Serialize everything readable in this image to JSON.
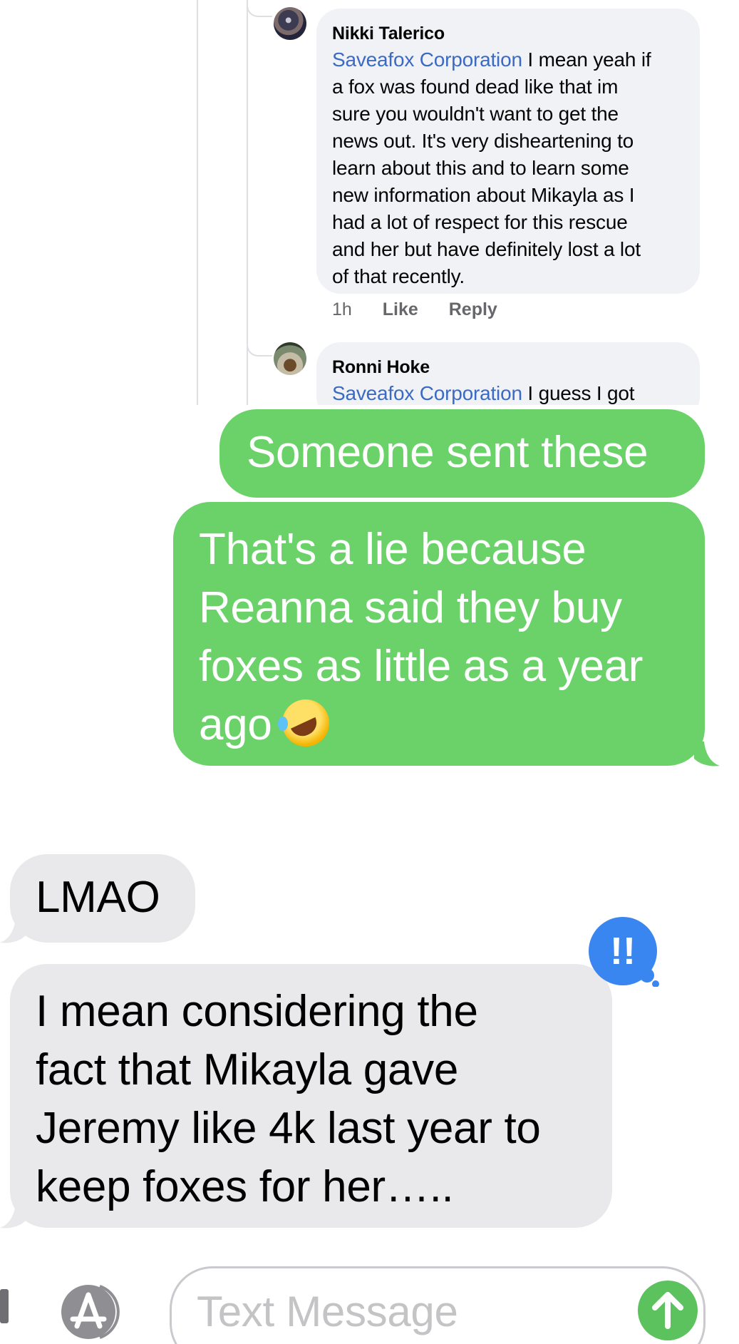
{
  "screenshot_comments": {
    "comment1": {
      "author": "Nikki Talerico",
      "mention": "Saveafox Corporation",
      "text_lines": [
        " I mean yeah if",
        "a fox was found dead like that im",
        "sure you wouldn't want to get the",
        "news out. It's very disheartening to",
        "learn about this and to learn some",
        "new information about Mikayla as I",
        "had a lot of respect for this rescue",
        "and her but have definitely lost a lot",
        "of that recently."
      ],
      "time": "1h",
      "like": "Like",
      "reply": "Reply"
    },
    "comment2": {
      "author": "Ronni Hoke",
      "mention": "Saveafox Corporation",
      "text": " I guess I got"
    }
  },
  "messages": {
    "sent1": "Someone sent these",
    "sent2_lines": [
      "That's a lie because",
      "Reanna said they buy",
      "foxes as little as a year",
      "ago"
    ],
    "received1": "LMAO",
    "received2_lines": [
      "I mean considering the",
      "fact that Mikayla gave",
      "Jeremy like 4k last year to",
      "keep foxes for her….."
    ]
  },
  "emoji": "rolling-on-floor-laughing",
  "tapback": {
    "symbol": "!!",
    "color": "#3a86f0"
  },
  "input": {
    "placeholder": "Text Message"
  },
  "colors": {
    "sent_bubble": "#6bd26a",
    "received_bubble": "#e9e9eb",
    "send_button": "#5bc25e",
    "mention": "#3b6ac4"
  }
}
